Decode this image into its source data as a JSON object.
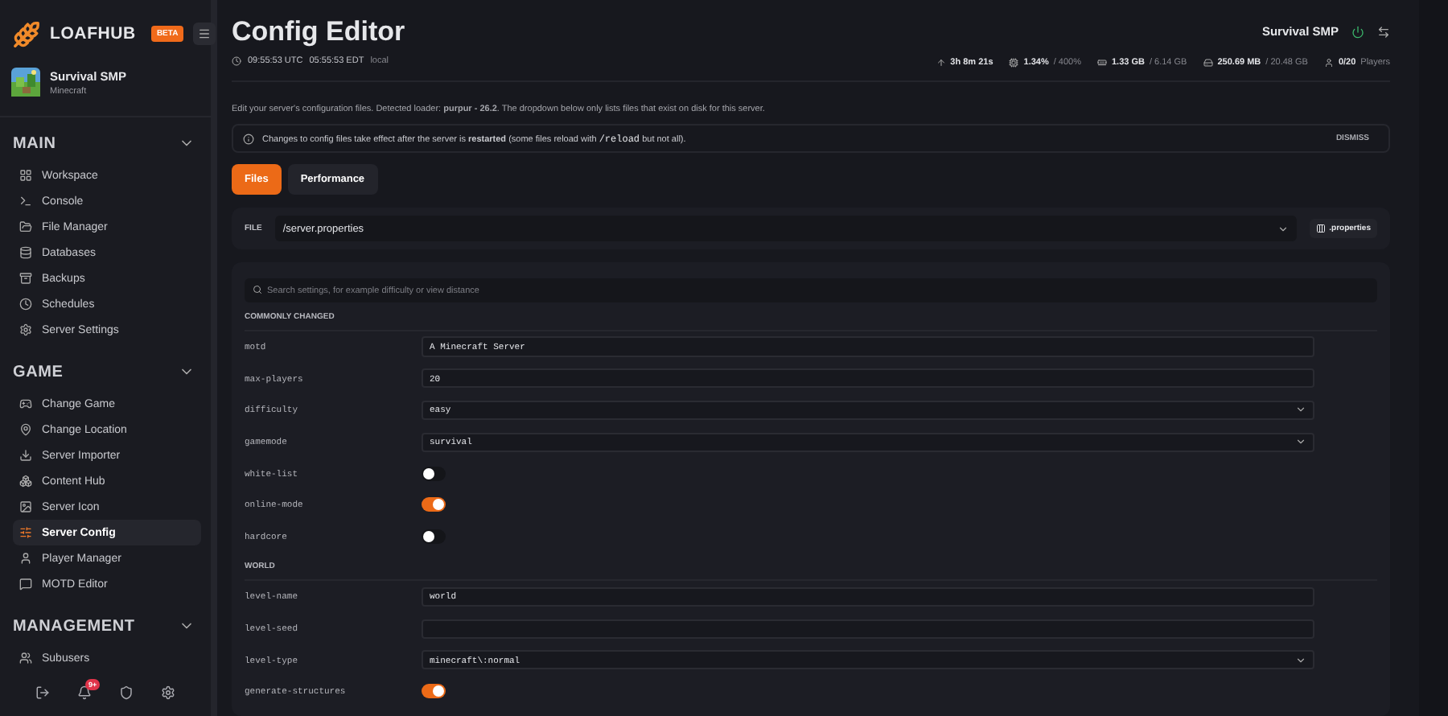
{
  "brand": {
    "name": "LOAFHUB",
    "badge": "BETA"
  },
  "server": {
    "name": "Survival SMP",
    "game": "Minecraft"
  },
  "sidebar": {
    "sections": [
      {
        "title": "MAIN",
        "expanded": true,
        "items": [
          {
            "label": "Workspace",
            "selected": false
          },
          {
            "label": "Console",
            "selected": false
          },
          {
            "label": "File Manager",
            "selected": false
          },
          {
            "label": "Databases",
            "selected": false
          },
          {
            "label": "Backups",
            "selected": false
          },
          {
            "label": "Schedules",
            "selected": false
          },
          {
            "label": "Server Settings",
            "selected": false
          }
        ]
      },
      {
        "title": "GAME",
        "expanded": true,
        "items": [
          {
            "label": "Change Game",
            "selected": false
          },
          {
            "label": "Change Location",
            "selected": false
          },
          {
            "label": "Server Importer",
            "selected": false
          },
          {
            "label": "Content Hub",
            "selected": false
          },
          {
            "label": "Server Icon",
            "selected": false
          },
          {
            "label": "Server Config",
            "selected": true
          },
          {
            "label": "Player Manager",
            "selected": false
          },
          {
            "label": "MOTD Editor",
            "selected": false
          }
        ]
      },
      {
        "title": "MANAGEMENT",
        "expanded": true,
        "items": [
          {
            "label": "Subusers",
            "selected": false
          }
        ]
      }
    ],
    "notification_count": "9+"
  },
  "header": {
    "title": "Config Editor",
    "utc": "09:55:53 UTC",
    "local_time": "05:55:53 EDT",
    "local_label": "local",
    "server_name": "Survival SMP",
    "stats": [
      {
        "value": "3h 8m 21s"
      },
      {
        "value": "1.34%",
        "total": "/ 400%"
      },
      {
        "value": "1.33 GB",
        "total": "/ 6.14 GB"
      },
      {
        "value": "250.69 MB",
        "total": "/ 20.48 GB"
      },
      {
        "value": "0/20",
        "total": "Players"
      }
    ]
  },
  "description": "Edit your server's configuration files. Detected loader: **purpur - 26.2**. The dropdown below only lists files that exist on disk for this server.",
  "notice": {
    "text": "Changes to config files take effect after the server is **restarted** (some files reload with",
    "code": "/reload",
    "tail": "but not all).",
    "dismiss": "DISMISS"
  },
  "tabs": [
    {
      "label": "Files",
      "selected": true
    },
    {
      "label": "Performance",
      "selected": false
    }
  ],
  "file": {
    "label": "FILE",
    "value": "/server.properties",
    "format": ".properties"
  },
  "search": {
    "placeholder": "Search settings, for example difficulty or view distance"
  },
  "groups": [
    {
      "title": "COMMONLY CHANGED",
      "settings": [
        {
          "key": "motd",
          "kind": "textarea",
          "value": "A Minecraft Server"
        },
        {
          "key": "max-players",
          "kind": "text",
          "value": "20"
        },
        {
          "key": "difficulty",
          "kind": "select",
          "value": "easy"
        },
        {
          "key": "gamemode",
          "kind": "select",
          "value": "survival"
        },
        {
          "key": "white-list",
          "kind": "toggle",
          "on": false
        },
        {
          "key": "online-mode",
          "kind": "toggle",
          "on": true
        },
        {
          "key": "hardcore",
          "kind": "toggle",
          "on": false
        }
      ]
    },
    {
      "title": "WORLD",
      "settings": [
        {
          "key": "level-name",
          "kind": "text",
          "value": "world"
        },
        {
          "key": "level-seed",
          "kind": "text"
        },
        {
          "key": "level-type",
          "kind": "select",
          "value": "minecraft\\:normal"
        },
        {
          "key": "generate-structures",
          "kind": "toggle",
          "on": true
        }
      ]
    }
  ]
}
